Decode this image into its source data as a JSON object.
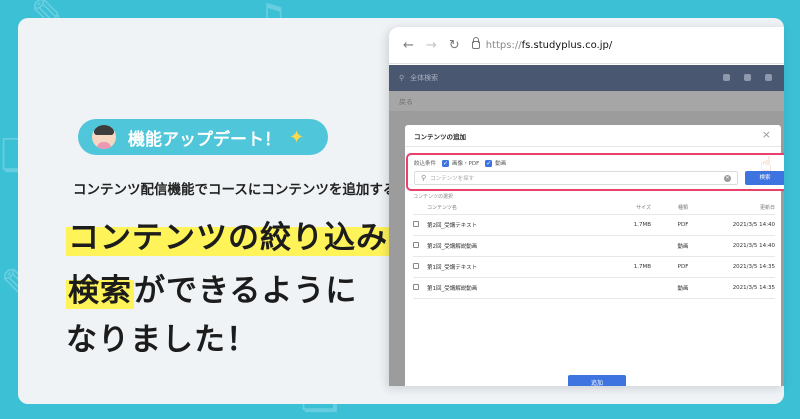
{
  "background": {
    "color": "#3cc0d6",
    "card_color": "#eff3f6"
  },
  "badge": {
    "text": "機能アップデート！",
    "color": "#4fc6d9",
    "left_icon": "woman-tipping-hand-icon",
    "right_icon": "party-popper-icon"
  },
  "subhead": "コンテンツ配信機能でコースにコンテンツを追加する時",
  "headline": {
    "line1_highlight": "コンテンツの絞り込み",
    "line2_highlight": "検索",
    "line2_rest": "ができるように",
    "line3": "なりました！",
    "highlight_color": "#fff35a"
  },
  "browser": {
    "url_protocol": "https://",
    "url_host": "fs.studyplus.co.jp/",
    "appbar_text": "全体検索",
    "subbar_text": "戻る"
  },
  "modal": {
    "title": "コンテンツの追加",
    "filter": {
      "label": "絞込条件",
      "option1": "画像・PDF",
      "option2": "動画",
      "search_placeholder": "コンテンツを探す",
      "search_button": "検索",
      "border_color": "#e9406c"
    },
    "table_caption": "コンテンツの選択",
    "columns": [
      "コンテンツ名",
      "サイズ",
      "種類",
      "更新日"
    ],
    "rows": [
      {
        "name": "第2回_受講テキスト",
        "size": "1.7MB",
        "type": "PDF",
        "date": "2021/3/5 14:40"
      },
      {
        "name": "第2回_受講解説動画",
        "size": "",
        "type": "動画",
        "date": "2021/3/5 14:40"
      },
      {
        "name": "第1回_受講テキスト",
        "size": "1.7MB",
        "type": "PDF",
        "date": "2021/3/5 14:35"
      },
      {
        "name": "第1回_受講解説動画",
        "size": "",
        "type": "動画",
        "date": "2021/3/5 14:35"
      }
    ],
    "add_button": "追加",
    "accent_color": "#3d74e0"
  }
}
